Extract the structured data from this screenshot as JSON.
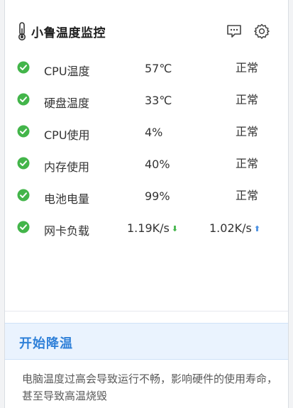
{
  "header": {
    "title": "小鲁温度监控",
    "icons": {
      "app": "thermometer-icon",
      "feedback": "chat-bubble-icon",
      "settings": "gear-icon"
    }
  },
  "metrics": [
    {
      "label": "CPU温度",
      "value": "57℃",
      "status": "正常"
    },
    {
      "label": "硬盘温度",
      "value": "33℃",
      "status": "正常"
    },
    {
      "label": "CPU使用",
      "value": "4%",
      "status": "正常"
    },
    {
      "label": "内存使用",
      "value": "40%",
      "status": "正常"
    },
    {
      "label": "电池电量",
      "value": "99%",
      "status": "正常"
    }
  ],
  "network": {
    "label": "网卡负载",
    "download": "1.19K/s",
    "download_arrow": "⬇",
    "upload": "1.02K/s",
    "upload_arrow": "⬆"
  },
  "cooling": {
    "button_label": "开始降温",
    "description": "电脑温度过高会导致运行不畅，影响硬件的使用寿命，甚至导致高温烧毁"
  },
  "colors": {
    "ok_green": "#43b54a",
    "accent_blue": "#2f80d8",
    "cool_bg": "#eaf3fe"
  }
}
